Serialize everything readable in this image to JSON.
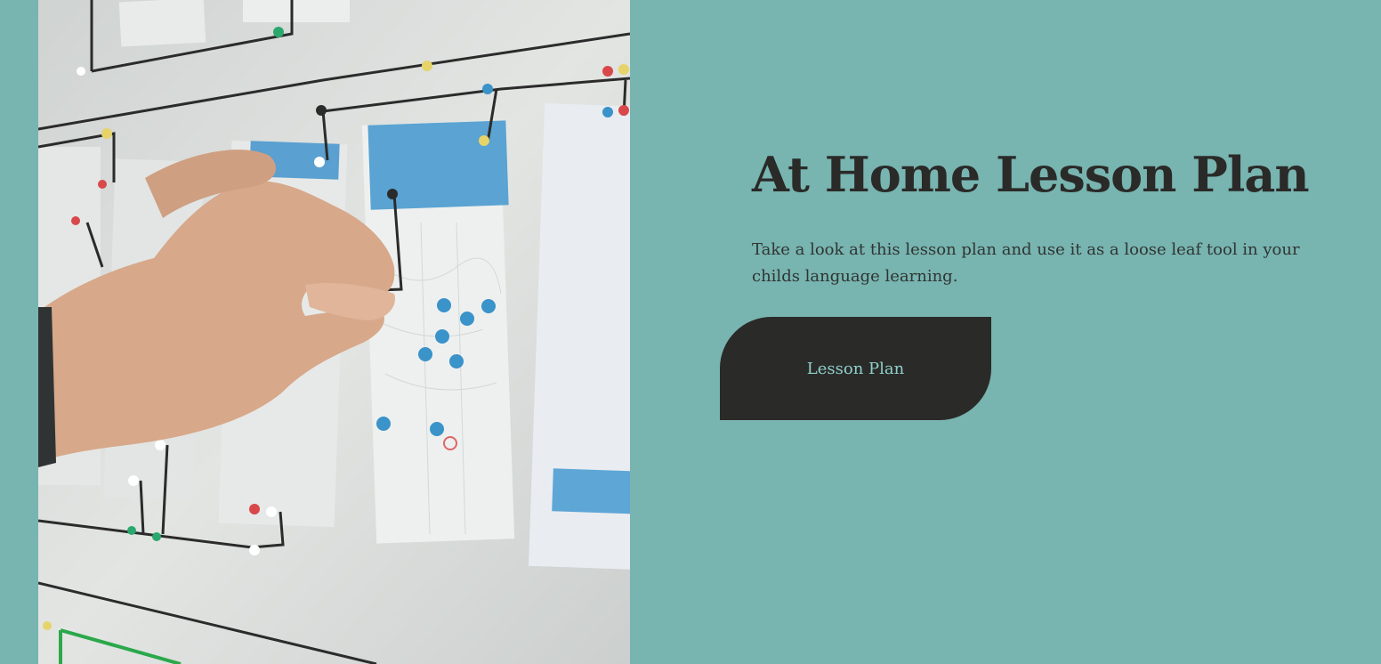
{
  "hero": {
    "image_alt": "Hand pinning app wireframe sketches connected with string on a whiteboard",
    "title": "At Home Lesson Plan",
    "description": "Take a look at this lesson plan and use it as a loose leaf tool in your childs language learning.",
    "button_label": "Lesson Plan"
  },
  "colors": {
    "background": "#78b4b0",
    "text": "#2a2a28",
    "button_bg": "#2a2a28",
    "button_text": "#8fd0ca"
  }
}
